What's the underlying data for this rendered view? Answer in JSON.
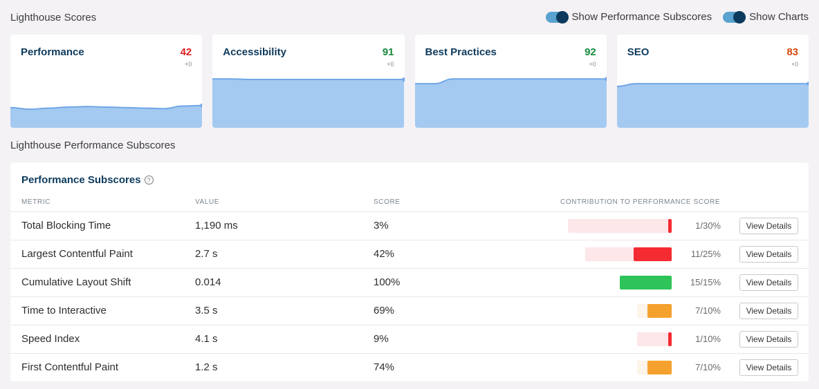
{
  "header": {
    "title": "Lighthouse Scores",
    "toggles": [
      {
        "label": "Show Performance Subscores",
        "on": true
      },
      {
        "label": "Show Charts",
        "on": true
      }
    ]
  },
  "colors": {
    "red": "#e02020",
    "green": "#178a3c",
    "orange": "#d4480d",
    "chart_fill": "#a5caf1",
    "chart_line": "#6fa6e6",
    "bar_red": "#f42b31",
    "bar_red_bg": "#fde7e8",
    "bar_green": "#2ec45a",
    "bar_orange": "#f5a12e",
    "bar_orange_bg": "#fdf4ea"
  },
  "cards": [
    {
      "title": "Performance",
      "score": "42",
      "delta": "+0",
      "status": "red",
      "trend": [
        38,
        35,
        37,
        39,
        40,
        39,
        38,
        37,
        36,
        41,
        42
      ]
    },
    {
      "title": "Accessibility",
      "score": "91",
      "delta": "+0",
      "status": "green",
      "trend": [
        92,
        92,
        91,
        91,
        91,
        91,
        91,
        91,
        91,
        91,
        91
      ]
    },
    {
      "title": "Best Practices",
      "score": "92",
      "delta": "+0",
      "status": "green",
      "trend": [
        83,
        83,
        92,
        92,
        92,
        92,
        92,
        92,
        92,
        92,
        92
      ]
    },
    {
      "title": "SEO",
      "score": "83",
      "delta": "+0",
      "status": "orange",
      "trend": [
        78,
        83,
        83,
        83,
        83,
        83,
        83,
        83,
        83,
        83,
        83
      ]
    }
  ],
  "subscores_section": {
    "title": "Lighthouse Performance Subscores",
    "panel_title": "Performance Subscores",
    "help_icon": "?",
    "columns": [
      "METRIC",
      "VALUE",
      "SCORE",
      "CONTRIBUTION TO PERFORMANCE SCORE"
    ],
    "button_label": "View Details",
    "rows": [
      {
        "metric": "Total Blocking Time",
        "value": "1,190 ms",
        "score": "3%",
        "contribution": 1,
        "weight": 30,
        "ratio": "1/30%",
        "status": "red"
      },
      {
        "metric": "Largest Contentful Paint",
        "value": "2.7 s",
        "score": "42%",
        "contribution": 11,
        "weight": 25,
        "ratio": "11/25%",
        "status": "red"
      },
      {
        "metric": "Cumulative Layout Shift",
        "value": "0.014",
        "score": "100%",
        "contribution": 15,
        "weight": 15,
        "ratio": "15/15%",
        "status": "green"
      },
      {
        "metric": "Time to Interactive",
        "value": "3.5 s",
        "score": "69%",
        "contribution": 7,
        "weight": 10,
        "ratio": "7/10%",
        "status": "orange"
      },
      {
        "metric": "Speed Index",
        "value": "4.1 s",
        "score": "9%",
        "contribution": 1,
        "weight": 10,
        "ratio": "1/10%",
        "status": "red"
      },
      {
        "metric": "First Contentful Paint",
        "value": "1.2 s",
        "score": "74%",
        "contribution": 7,
        "weight": 10,
        "ratio": "7/10%",
        "status": "orange"
      }
    ]
  }
}
